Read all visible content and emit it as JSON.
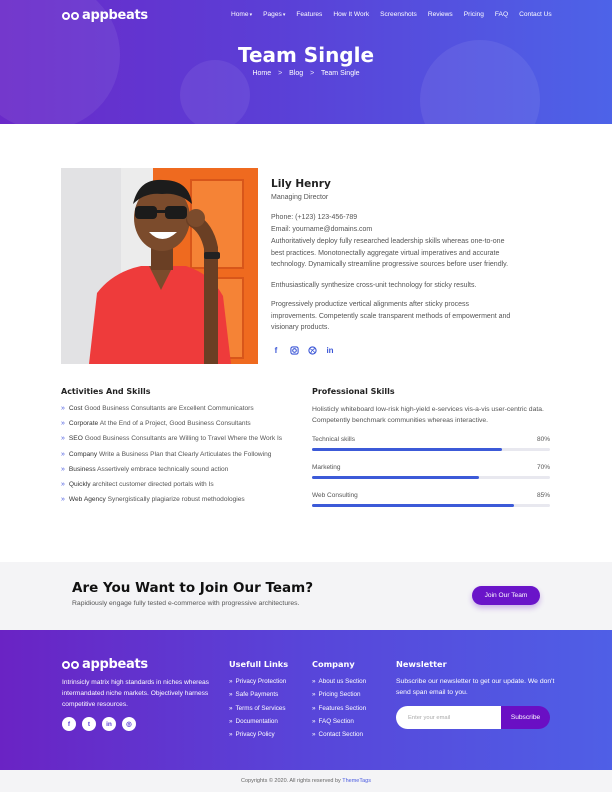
{
  "brand": {
    "name": "appbeats"
  },
  "nav": {
    "items": [
      {
        "label": "Home",
        "dropdown": true
      },
      {
        "label": "Pages",
        "dropdown": true
      },
      {
        "label": "Features"
      },
      {
        "label": "How It Work"
      },
      {
        "label": "Screenshots"
      },
      {
        "label": "Reviews"
      },
      {
        "label": "Pricing"
      },
      {
        "label": "FAQ"
      },
      {
        "label": "Contact Us"
      }
    ]
  },
  "hero": {
    "title": "Team Single",
    "breadcrumb": [
      "Home",
      "Blog",
      "Team Single"
    ],
    "separator": ">"
  },
  "profile": {
    "name": "Lily Henry",
    "role": "Managing Director",
    "phone": "Phone: (+123) 123-456-789",
    "email": "Email: yourname@domains.com",
    "bio": [
      "Authoritatively deploy fully researched leadership skills whereas one-to-one best practices. Monotonectally aggregate virtual imperatives and accurate technology. Dynamically streamline progressive sources before user friendly.",
      "Enthusiastically synthesize cross-unit technology for sticky results.",
      "Progressively productize vertical alignments after sticky process improvements. Competently scale transparent methods of empowerment and visionary products."
    ],
    "socials": [
      "facebook-icon",
      "instagram-icon",
      "dribbble-icon",
      "linkedin-icon"
    ]
  },
  "activities": {
    "title": "Activities And Skills",
    "items": [
      {
        "lead": "Cost",
        "text": "Good Business Consultants are Excellent Communicators"
      },
      {
        "lead": "Corporate",
        "text": "At the End of a Project, Good Business Consultants"
      },
      {
        "lead": "SEO",
        "text": "Good Business Consultants are Willing to Travel Where the Work Is"
      },
      {
        "lead": "Company",
        "text": "Write a Business Plan that Clearly Articulates the Following"
      },
      {
        "lead": "Business",
        "text": "Assertively embrace technically sound action"
      },
      {
        "lead": "Quickly",
        "text": "architect customer directed portals with Is"
      },
      {
        "lead": "Web Agency",
        "text": "Synergistically plagiarize robust methodologies"
      }
    ]
  },
  "professional": {
    "title": "Professional Skills",
    "description": "Holisticly whiteboard low-risk high-yield e-services vis-a-vis user-centric data. Competently benchmark communities whereas interactive.",
    "skills": [
      {
        "name": "Technical skills",
        "percent_label": "80%",
        "value": 80
      },
      {
        "name": "Marketing",
        "percent_label": "70%",
        "value": 70
      },
      {
        "name": "Web Consulting",
        "percent_label": "85%",
        "value": 85
      }
    ]
  },
  "cta": {
    "title": "Are You Want to Join Our Team?",
    "subtitle": "Rapidiously engage fully tested e-commerce with progressive architectures.",
    "button": "Join Our Team"
  },
  "footer": {
    "about": "Intrinsicly matrix high standards in niches whereas intermandated niche markets. Objectively harness competitive resources.",
    "socials": [
      "facebook-icon",
      "twitter-icon",
      "linkedin-icon",
      "dribbble-icon"
    ],
    "useful": {
      "title": "Usefull Links",
      "items": [
        "Privacy Protection",
        "Safe Payments",
        "Terms of Services",
        "Documentation",
        "Privacy Policy"
      ]
    },
    "company": {
      "title": "Company",
      "items": [
        "About us Section",
        "Pricing Section",
        "Features Section",
        "FAQ Section",
        "Contact Section"
      ]
    },
    "newsletter": {
      "title": "Newsletter",
      "text": "Subscribe our newsletter to get our update. We don't send span email to you.",
      "placeholder": "Enter your email",
      "button": "Subscribe"
    },
    "copyright": "Copyrights © 2020. All rights reserved by",
    "copyright_link": "ThemeTags"
  },
  "colors": {
    "accent": "#3c5ad8",
    "cta_button": "#6a14c9"
  }
}
